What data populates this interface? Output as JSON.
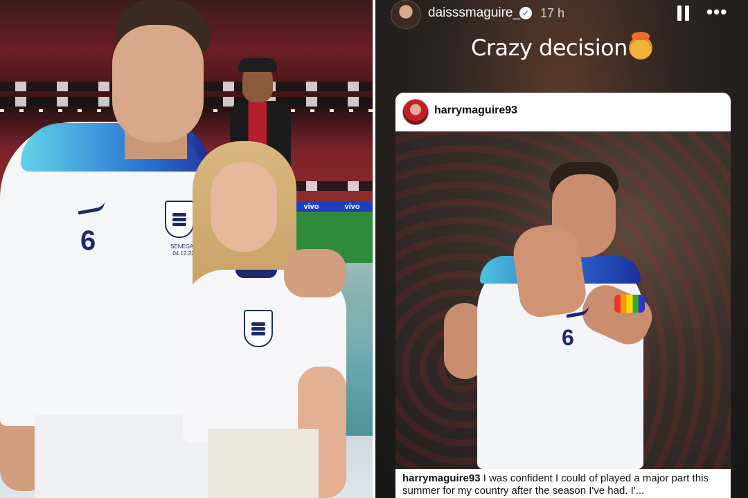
{
  "left_photo": {
    "ad_boards": [
      "vivo",
      "vivo"
    ],
    "man_shirt": {
      "number": "6",
      "match_text": "SENEGAL",
      "match_date": "04.12.22"
    }
  },
  "story": {
    "header": {
      "username": "daisssmaguire_",
      "time": "17 h",
      "icons": [
        "verified-badge-icon",
        "pause-icon",
        "more-options-icon"
      ]
    },
    "caption_text": "Crazy decision",
    "caption_emoji": "exploding-head-emoji",
    "shared_post": {
      "username": "harrymaguire93",
      "player_number": "6",
      "caption_user": "harrymaguire93",
      "caption_text": " I was confident I could of played a major part this summer for my country after the season I've had. I'..."
    }
  },
  "colors": {
    "england_navy": "#1b2a6b",
    "story_text": "#ffffff",
    "card_bg": "#ffffff"
  }
}
